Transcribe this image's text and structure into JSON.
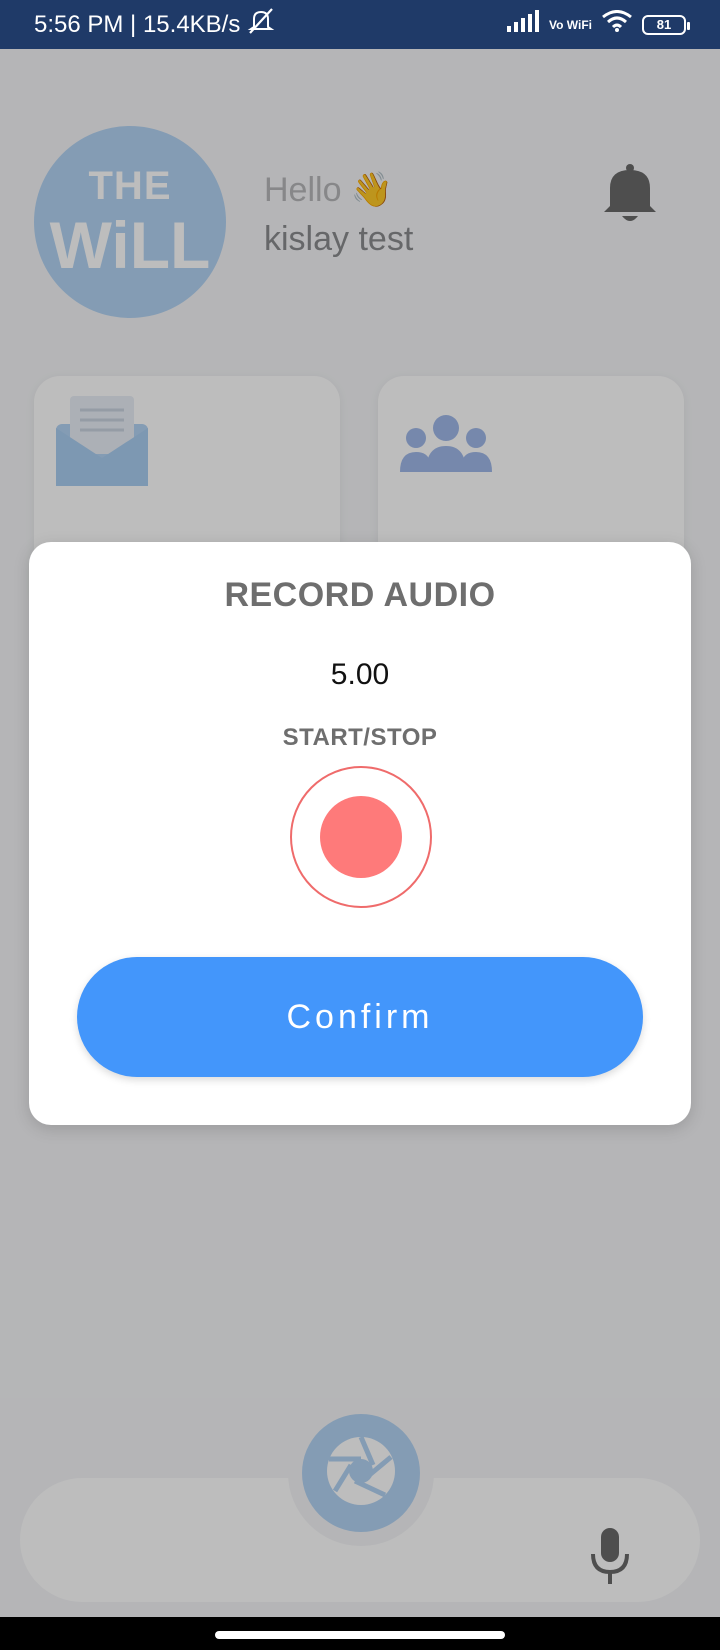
{
  "status_bar": {
    "time_speed": "5:56 PM | 15.4KB/s",
    "network_label": "Vo WiFi",
    "battery": "81"
  },
  "app": {
    "logo_top": "THE",
    "logo_bottom": "WiLL",
    "greeting": "Hello 👋",
    "user_name": "kislay test"
  },
  "dialog": {
    "title": "RECORD AUDIO",
    "timer": "5.00",
    "start_stop_label": "START/STOP",
    "confirm_label": "Confirm"
  },
  "colors": {
    "status_bar": "#1f3a68",
    "accent_blue": "#4396fb",
    "record_red": "#fe7a7a",
    "logo_blue": "#b3d3f3"
  }
}
